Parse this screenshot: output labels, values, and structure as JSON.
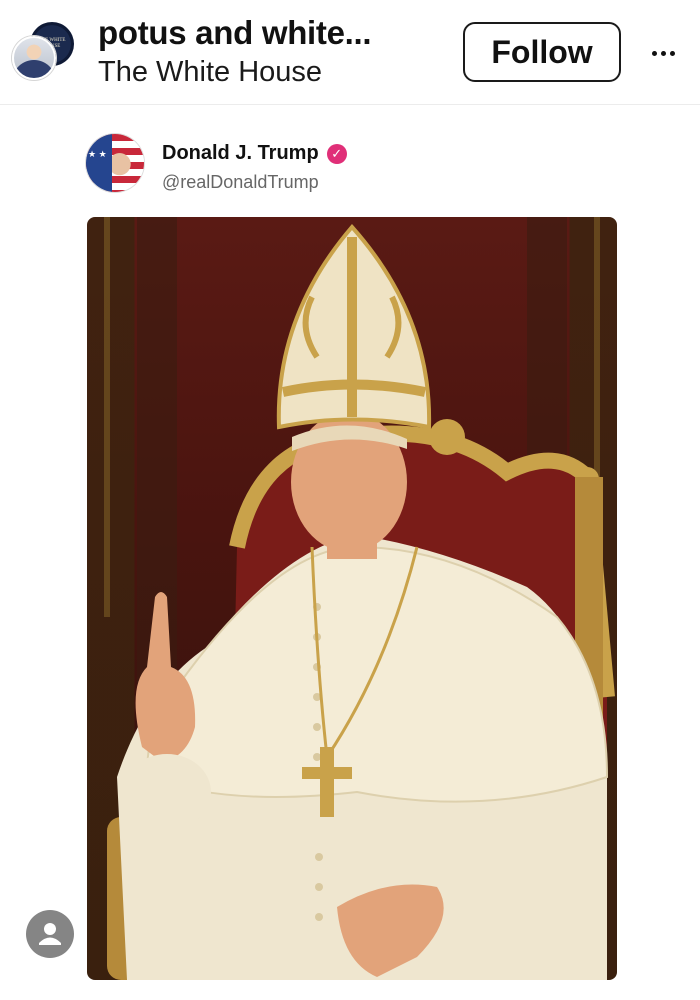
{
  "header": {
    "account_name": "potus and white...",
    "account_subtitle": "The White House",
    "follow_label": "Follow",
    "seal_text": "THE WHITE HOUSE"
  },
  "tweet": {
    "display_name": "Donald J. Trump",
    "handle": "@realDonaldTrump",
    "verified": true,
    "verified_color": "#e02f78"
  },
  "image": {
    "description_icon": "photo",
    "accent_gold": "#c9a24a",
    "robe_color": "#efe6cf",
    "backdrop_color": "#4a140f"
  },
  "icons": {
    "more": "more-horizontal-icon",
    "user": "user-icon",
    "verified": "verified-badge-icon"
  }
}
